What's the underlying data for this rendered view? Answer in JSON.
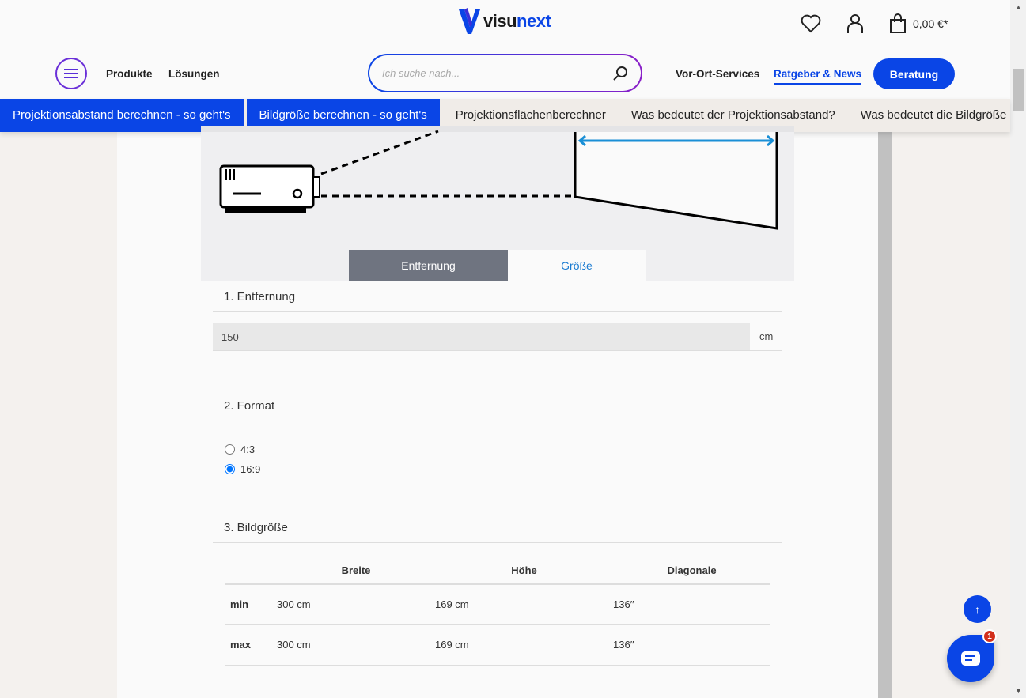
{
  "header": {
    "logo": "visunext",
    "logo_a": "visu",
    "logo_b": "next",
    "cart_total": "0,00 €*",
    "nav_left": [
      "Produkte",
      "Lösungen"
    ],
    "search_placeholder": "Ich suche nach...",
    "nav_right": [
      "Vor-Ort-Services",
      "Ratgeber & News"
    ],
    "cta": "Beratung"
  },
  "subnav": [
    "Projektionsabstand berechnen - so geht's",
    "Bildgröße berechnen - so geht's",
    "Projektionsflächenberechner",
    "Was bedeutet der Projektionsabstand?",
    "Was bedeutet die Bildgröße"
  ],
  "calculator": {
    "tabs": [
      "Entfernung",
      "Größe"
    ],
    "distance": {
      "title": "1. Entfernung",
      "value": "150",
      "unit": "cm"
    },
    "format": {
      "title": "2. Format",
      "options": [
        "4:3",
        "16:9"
      ],
      "selected": "16:9"
    },
    "size": {
      "title": "3. Bildgröße",
      "columns": [
        "",
        "Breite",
        "Höhe",
        "Diagonale"
      ],
      "rows": [
        [
          "min",
          "300 cm",
          "169 cm",
          "136′′"
        ],
        [
          "max",
          "300 cm",
          "169 cm",
          "136′′"
        ]
      ]
    }
  },
  "widgets": {
    "chat_badge": "1",
    "to_top": "↑"
  },
  "colors": {
    "brand": "#0a45e6",
    "accent": "#8a1fc8",
    "arrow": "#1a8fd6"
  }
}
